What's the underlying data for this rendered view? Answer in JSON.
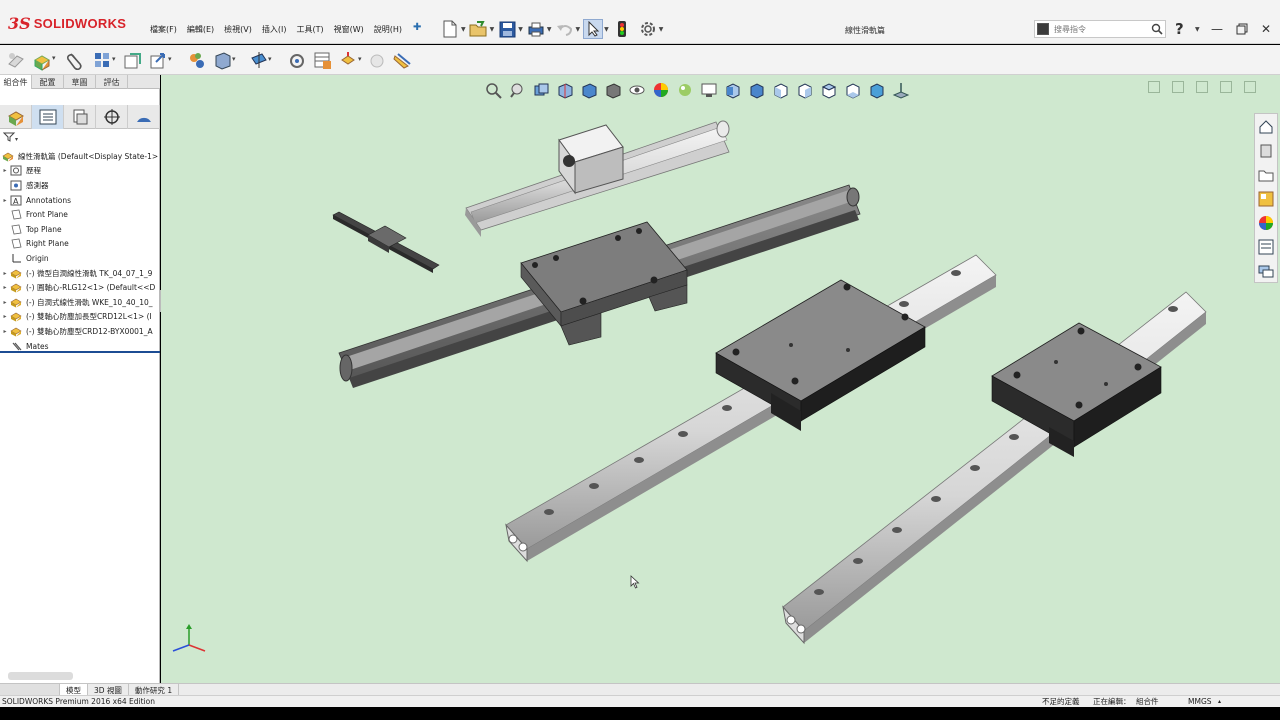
{
  "app": {
    "logo_prefix": "3S",
    "logo_text": "SOLIDWORKS",
    "document_title": "線性滑軌篇",
    "status_product": "SOLIDWORKS Premium 2016 x64 Edition"
  },
  "menu": [
    "檔案(F)",
    "編輯(E)",
    "檢視(V)",
    "插入(I)",
    "工具(T)",
    "視窗(W)",
    "說明(H)"
  ],
  "search": {
    "placeholder": "搜尋指令"
  },
  "panel_tabs": [
    "組合件",
    "配置",
    "草圖",
    "評估"
  ],
  "tree": {
    "root": "線性滑軌篇  (Default<Display State-1>",
    "items": [
      {
        "label": "歷程",
        "icon": "history-icon",
        "expander": "▸"
      },
      {
        "label": "感測器",
        "icon": "sensor-icon",
        "expander": ""
      },
      {
        "label": "Annotations",
        "icon": "annotations-icon",
        "expander": "▸"
      },
      {
        "label": "Front Plane",
        "icon": "plane-icon",
        "expander": ""
      },
      {
        "label": "Top Plane",
        "icon": "plane-icon",
        "expander": ""
      },
      {
        "label": "Right Plane",
        "icon": "plane-icon",
        "expander": ""
      },
      {
        "label": "Origin",
        "icon": "origin-icon",
        "expander": ""
      },
      {
        "label": "(-) 微型自潤線性滑軌 TK_04_07_1_9",
        "icon": "component-icon",
        "expander": "▸"
      },
      {
        "label": "(-) 圓軸心-RLG12<1> (Default<<D",
        "icon": "component-icon",
        "expander": "▸"
      },
      {
        "label": "(-) 自潤式線性滑軌 WKE_10_40_10_",
        "icon": "component-icon",
        "expander": "▸"
      },
      {
        "label": "(-) 雙軸心防塵加長型CRD12L<1> (I",
        "icon": "component-icon",
        "expander": "▸"
      },
      {
        "label": "(-) 雙軸心防塵型CRD12-BYX0001_A",
        "icon": "component-icon",
        "expander": "▸"
      },
      {
        "label": "Mates",
        "icon": "mates-icon",
        "expander": ""
      }
    ]
  },
  "bottom_tabs": [
    "模型",
    "3D 視圖",
    "動作研究 1"
  ],
  "status": {
    "underdefined": "不足的定義",
    "editing": "正在編輯：",
    "editing_target": "組合件",
    "units": "MMGS"
  },
  "colors": {
    "viewport_bg": "#cfe8cf",
    "brand_red": "#d8232a",
    "tree_separator": "#1c4c93"
  }
}
